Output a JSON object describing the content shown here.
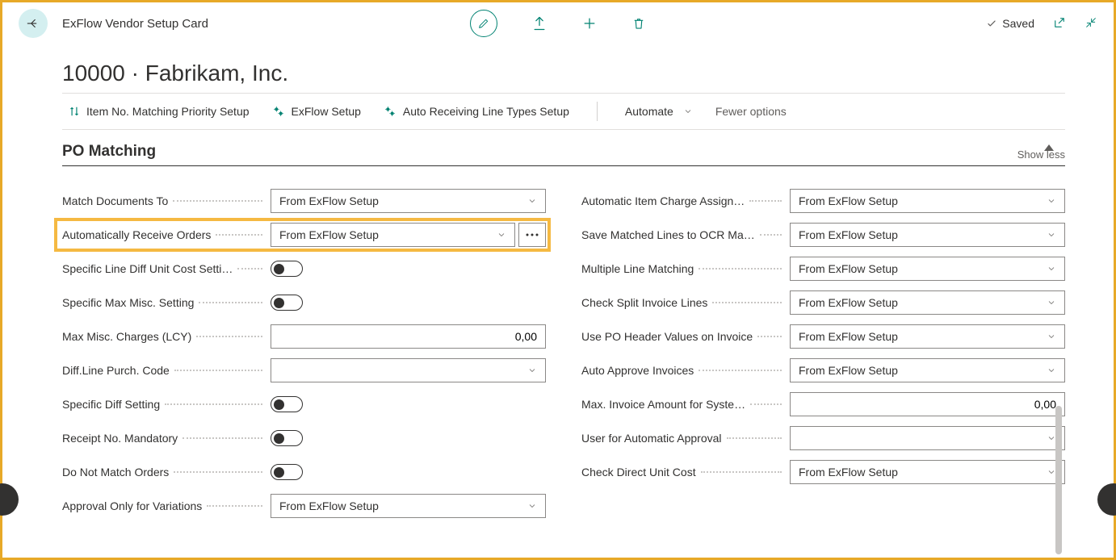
{
  "header": {
    "breadcrumb": "ExFlow Vendor Setup Card",
    "status": "Saved"
  },
  "page_title": "10000 · Fabrikam, Inc.",
  "actions": {
    "item_no": "Item No. Matching Priority Setup",
    "exflow_setup": "ExFlow Setup",
    "auto_recv": "Auto Receiving Line Types Setup",
    "automate": "Automate",
    "fewer": "Fewer options"
  },
  "section": {
    "title": "PO Matching",
    "show_less": "Show less"
  },
  "left": {
    "match_docs": {
      "label": "Match Documents To",
      "value": "From ExFlow Setup"
    },
    "auto_receive": {
      "label": "Automatically Receive Orders",
      "value": "From ExFlow Setup"
    },
    "spec_line_diff": {
      "label": "Specific Line Diff Unit Cost Setti…"
    },
    "spec_max_misc": {
      "label": "Specific Max Misc. Setting"
    },
    "max_misc": {
      "label": "Max Misc. Charges (LCY)",
      "value": "0,00"
    },
    "diff_line": {
      "label": "Diff.Line Purch. Code",
      "value": ""
    },
    "spec_diff": {
      "label": "Specific Diff Setting"
    },
    "receipt_no": {
      "label": "Receipt No. Mandatory"
    },
    "do_not_match": {
      "label": "Do Not Match Orders"
    },
    "approval_only": {
      "label": "Approval Only for Variations",
      "value": "From ExFlow Setup"
    }
  },
  "right": {
    "auto_item_charge": {
      "label": "Automatic Item Charge Assign…",
      "value": "From ExFlow Setup"
    },
    "save_matched": {
      "label": "Save Matched Lines to OCR Ma…",
      "value": "From ExFlow Setup"
    },
    "multi_line": {
      "label": "Multiple Line Matching",
      "value": "From ExFlow Setup"
    },
    "check_split": {
      "label": "Check Split Invoice Lines",
      "value": "From ExFlow Setup"
    },
    "use_po_header": {
      "label": "Use PO Header Values on Invoice",
      "value": "From ExFlow Setup"
    },
    "auto_approve": {
      "label": "Auto Approve Invoices",
      "value": "From ExFlow Setup"
    },
    "max_invoice": {
      "label": "Max. Invoice Amount for Syste…",
      "value": "0,00"
    },
    "user_auto": {
      "label": "User for Automatic Approval",
      "value": ""
    },
    "check_direct": {
      "label": "Check Direct Unit Cost",
      "value": "From ExFlow Setup"
    }
  }
}
